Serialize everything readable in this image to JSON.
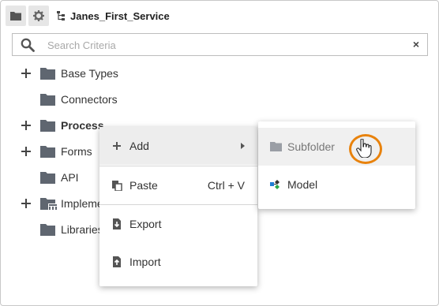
{
  "toolbar": {
    "folder_icon": "folder-icon",
    "settings_icon": "gear-icon",
    "service_icon": "service-tree-icon",
    "service_name": "Janes_First_Service"
  },
  "search": {
    "placeholder": "Search Criteria",
    "value": "",
    "clear_label": "×"
  },
  "tree": [
    {
      "label": "Base Types",
      "expandable": true,
      "bold": false
    },
    {
      "label": "Connectors",
      "expandable": false,
      "bold": false
    },
    {
      "label": "Process",
      "expandable": true,
      "bold": true
    },
    {
      "label": "Forms",
      "expandable": true,
      "bold": false
    },
    {
      "label": "API",
      "expandable": false,
      "bold": false
    },
    {
      "label": "Impleme",
      "expandable": true,
      "bold": false
    },
    {
      "label": "Libraries",
      "expandable": false,
      "bold": false
    }
  ],
  "context_menu": {
    "add": {
      "label": "Add",
      "icon": "plus-icon"
    },
    "paste": {
      "label": "Paste",
      "shortcut": "Ctrl + V",
      "icon": "paste-icon"
    },
    "export": {
      "label": "Export",
      "icon": "export-icon"
    },
    "import": {
      "label": "Import",
      "icon": "import-icon"
    }
  },
  "submenu": {
    "subfolder": {
      "label": "Subfolder",
      "icon": "folder-icon"
    },
    "model": {
      "label": "Model",
      "icon": "model-icon"
    }
  },
  "colors": {
    "accent_ring": "#e8820c",
    "folder": "#5f6670",
    "highlight": "#ededed"
  }
}
